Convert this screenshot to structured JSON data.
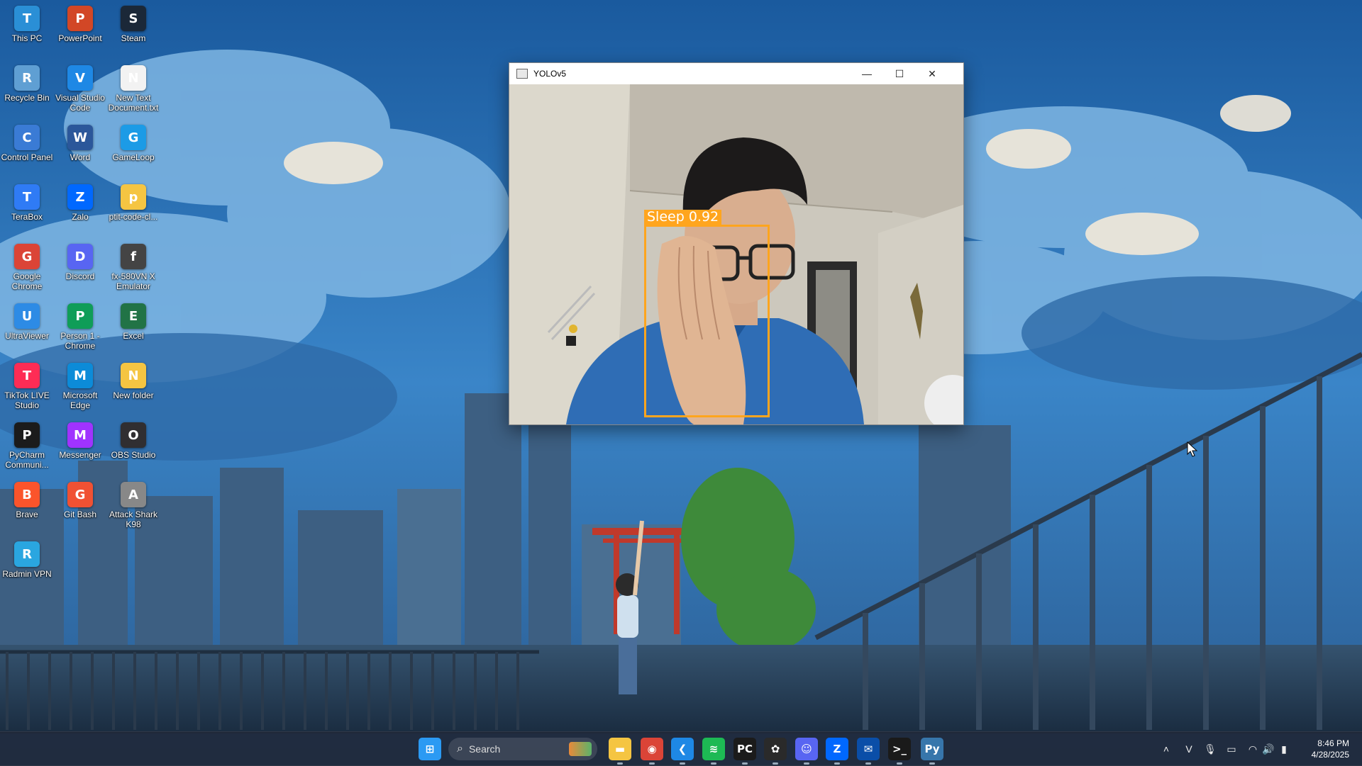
{
  "desktop": {
    "icons": [
      {
        "label": "This PC",
        "icon": "this-pc-icon",
        "color": "#2a8fd6"
      },
      {
        "label": "PowerPoint",
        "icon": "powerpoint-icon",
        "color": "#d24726"
      },
      {
        "label": "Steam",
        "icon": "steam-icon",
        "color": "#1b2838"
      },
      {
        "label": "Recycle Bin",
        "icon": "recycle-bin-icon",
        "color": "#5f9fd3"
      },
      {
        "label": "Visual Studio Code",
        "icon": "vscode-icon",
        "color": "#1e88e5"
      },
      {
        "label": "New Text Document.txt",
        "icon": "text-document-icon",
        "color": "#f2f2f2"
      },
      {
        "label": "Control Panel",
        "icon": "control-panel-icon",
        "color": "#3a7bd5"
      },
      {
        "label": "Word",
        "icon": "word-icon",
        "color": "#2b579a"
      },
      {
        "label": "GameLoop",
        "icon": "gameloop-icon",
        "color": "#1c9be6"
      },
      {
        "label": "TeraBox",
        "icon": "terabox-icon",
        "color": "#2f7bf5"
      },
      {
        "label": "Zalo",
        "icon": "zalo-icon",
        "color": "#0068ff"
      },
      {
        "label": "ptit-code-cl...",
        "icon": "folder-icon",
        "color": "#f5c542"
      },
      {
        "label": "Google Chrome",
        "icon": "chrome-icon",
        "color": "#db4437"
      },
      {
        "label": "Discord",
        "icon": "discord-icon",
        "color": "#5865f2"
      },
      {
        "label": "fx-580VN X Emulator",
        "icon": "calculator-icon",
        "color": "#444444"
      },
      {
        "label": "UltraViewer",
        "icon": "ultraviewer-icon",
        "color": "#2d8be5"
      },
      {
        "label": "Person 1 - Chrome",
        "icon": "chrome-profile-icon",
        "color": "#0f9d58"
      },
      {
        "label": "Excel",
        "icon": "excel-icon",
        "color": "#217346"
      },
      {
        "label": "TikTok LIVE Studio",
        "icon": "tiktok-icon",
        "color": "#fe2c55"
      },
      {
        "label": "Microsoft Edge",
        "icon": "edge-icon",
        "color": "#0c8bd8"
      },
      {
        "label": "New folder",
        "icon": "folder-icon",
        "color": "#f5c542"
      },
      {
        "label": "PyCharm Communi...",
        "icon": "pycharm-icon",
        "color": "#1b1b1b"
      },
      {
        "label": "Messenger",
        "icon": "messenger-icon",
        "color": "#a033ff"
      },
      {
        "label": "OBS Studio",
        "icon": "obs-icon",
        "color": "#302e31"
      },
      {
        "label": "Brave",
        "icon": "brave-icon",
        "color": "#fb542b"
      },
      {
        "label": "Git Bash",
        "icon": "git-bash-icon",
        "color": "#f05133"
      },
      {
        "label": "Attack Shark K98",
        "icon": "attack-shark-icon",
        "color": "#888888"
      },
      {
        "label": "Radmin VPN",
        "icon": "radmin-vpn-icon",
        "color": "#2aa6e0"
      }
    ]
  },
  "window": {
    "title": "YOLOv5",
    "minimize_glyph": "—",
    "maximize_glyph": "☐",
    "close_glyph": "✕"
  },
  "detection": {
    "label": "Sleep 0.92",
    "box_color": "#ffa51e"
  },
  "taskbar": {
    "search_placeholder": "Search",
    "apps": [
      {
        "name": "start",
        "icon": "windows-start-icon",
        "glyph": "⊞",
        "color": "#2b9af3"
      },
      {
        "name": "file-explorer",
        "icon": "file-explorer-icon",
        "glyph": "▬",
        "color": "#f5c542"
      },
      {
        "name": "chrome",
        "icon": "chrome-icon",
        "glyph": "◉",
        "color": "#db4437"
      },
      {
        "name": "vscode",
        "icon": "vscode-icon",
        "glyph": "❮",
        "color": "#1e88e5"
      },
      {
        "name": "spotify",
        "icon": "spotify-icon",
        "glyph": "≋",
        "color": "#1db954"
      },
      {
        "name": "pycharm",
        "icon": "pycharm-icon",
        "glyph": "PC",
        "color": "#1b1b1b"
      },
      {
        "name": "chatgpt",
        "icon": "chatgpt-icon",
        "glyph": "✿",
        "color": "#2a2a2a"
      },
      {
        "name": "discord",
        "icon": "discord-icon",
        "glyph": "☺",
        "color": "#5865f2"
      },
      {
        "name": "zalo",
        "icon": "zalo-icon",
        "glyph": "Z",
        "color": "#0068ff"
      },
      {
        "name": "mail",
        "icon": "mail-icon",
        "glyph": "✉",
        "color": "#0a4ea8"
      },
      {
        "name": "terminal",
        "icon": "terminal-icon",
        "glyph": ">_",
        "color": "#1a1a1a"
      },
      {
        "name": "python",
        "icon": "python-icon",
        "glyph": "Py",
        "color": "#3776ab"
      }
    ],
    "tray": {
      "chevron": "˄",
      "vpn": "V",
      "mic": "🎙",
      "battery_hint": "▭",
      "wifi": "◠",
      "speaker": "🔊",
      "power": "▮"
    },
    "clock": {
      "time": "8:46 PM",
      "date": "4/28/2025"
    }
  }
}
